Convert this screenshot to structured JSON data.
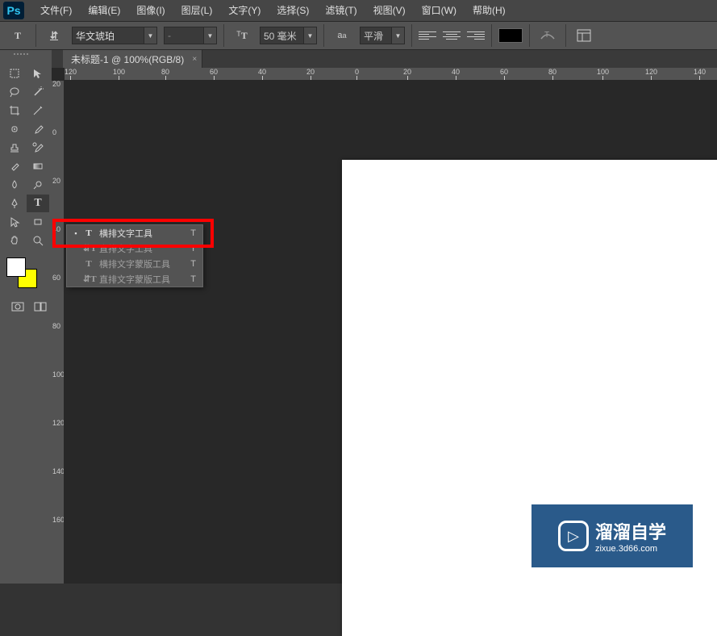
{
  "menu": {
    "file": "文件(F)",
    "edit": "编辑(E)",
    "image": "图像(I)",
    "layer": "图层(L)",
    "type": "文字(Y)",
    "select": "选择(S)",
    "filter": "滤镜(T)",
    "view": "视图(V)",
    "window": "窗口(W)",
    "help": "帮助(H)"
  },
  "options": {
    "font_family": "华文琥珀",
    "font_style": "-",
    "font_size": "50 毫米",
    "aa_label": "平滑",
    "type_icon": "T",
    "orientation_icon": "⇵T"
  },
  "doc": {
    "tab_title": "未标题-1 @ 100%(RGB/8)"
  },
  "ruler_h": [
    "120",
    "100",
    "80",
    "60",
    "40",
    "20",
    "0",
    "20",
    "40",
    "60",
    "80",
    "100",
    "120",
    "140"
  ],
  "ruler_v": [
    "20",
    "0",
    "20",
    "40",
    "60",
    "80",
    "100",
    "120",
    "140",
    "160"
  ],
  "context": {
    "items": [
      {
        "label": "横排文字工具",
        "shortcut": "T",
        "active": true,
        "icon": "T"
      },
      {
        "label": "直排文字工具",
        "shortcut": "T",
        "active": false,
        "icon": "⇵T"
      },
      {
        "label": "横排文字蒙版工具",
        "shortcut": "T",
        "active": false,
        "icon": "T"
      },
      {
        "label": "直排文字蒙版工具",
        "shortcut": "T",
        "active": false,
        "icon": "⇵T"
      }
    ]
  },
  "watermark": {
    "title": "溜溜自学",
    "sub": "zixue.3d66.com"
  },
  "ps_logo": "Ps"
}
